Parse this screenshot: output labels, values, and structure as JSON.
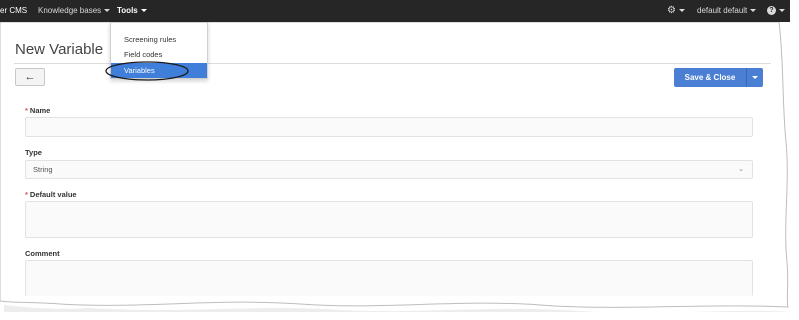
{
  "nav": {
    "brand": "er CMS",
    "knowledge_bases": "Knowledge bases",
    "tools": "Tools",
    "user": "default default"
  },
  "tools_menu": {
    "items": [
      {
        "label": "Screening rules",
        "active": false
      },
      {
        "label": "Field codes",
        "active": false
      },
      {
        "label": "Variables",
        "active": true
      }
    ]
  },
  "page": {
    "title": "New Variable",
    "back_icon": "arrow-left-icon",
    "save_label": "Save & Close"
  },
  "form": {
    "name_label": "Name",
    "name_value": "",
    "type_label": "Type",
    "type_value": "String",
    "default_label": "Default value",
    "default_value": "",
    "comment_label": "Comment",
    "comment_value": ""
  },
  "colors": {
    "navbar": "#262626",
    "primary": "#4a7fd4",
    "menu_active": "#3f7fd9",
    "required": "#d9534f"
  }
}
